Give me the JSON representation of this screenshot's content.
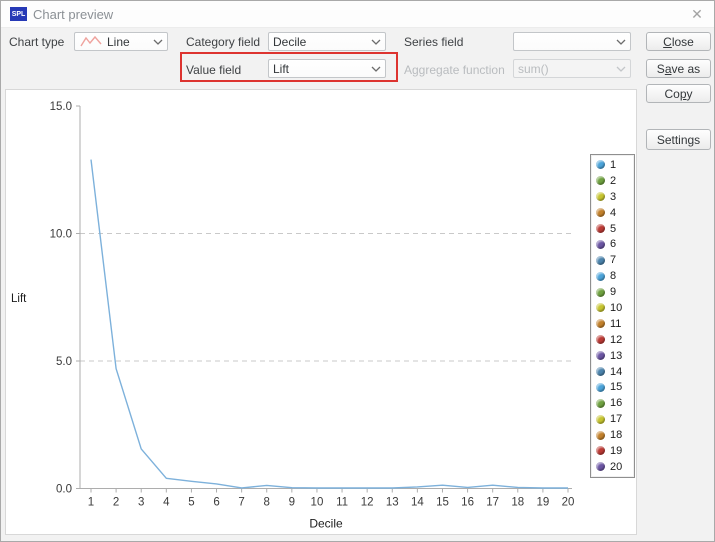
{
  "window": {
    "app_badge": "SPL",
    "title": "Chart preview",
    "close_glyph": "✕"
  },
  "toolbar": {
    "chart_type": {
      "label": "Chart type",
      "value": "Line"
    },
    "category_field": {
      "label": "Category field",
      "value": "Decile"
    },
    "series_field": {
      "label": "Series field",
      "value": ""
    },
    "value_field": {
      "label": "Value field",
      "value": "Lift"
    },
    "aggregate_function": {
      "label": "Aggregate function",
      "value": "sum()",
      "disabled": true
    },
    "highlight_color": "#dd3430"
  },
  "buttons": {
    "close": {
      "pre": "",
      "key": "C",
      "post": "lose"
    },
    "save_as": {
      "pre": "S",
      "key": "a",
      "post": "ve as"
    },
    "copy": {
      "pre": "Co",
      "key": "p",
      "post": "y"
    },
    "settings": {
      "pre": "Settings",
      "key": "",
      "post": ""
    }
  },
  "chart_data": {
    "type": "line",
    "title": "",
    "xlabel": "Decile",
    "ylabel": "Lift",
    "x": [
      1,
      2,
      3,
      4,
      5,
      6,
      7,
      8,
      9,
      10,
      11,
      12,
      13,
      14,
      15,
      16,
      17,
      18,
      19,
      20
    ],
    "series": [
      {
        "name": "Lift",
        "values": [
          12.9,
          4.7,
          1.55,
          0.4,
          0.28,
          0.18,
          0.02,
          0.12,
          0.03,
          0.02,
          0.02,
          0.02,
          0.02,
          0.06,
          0.13,
          0.04,
          0.13,
          0.04,
          0.02,
          0.02
        ]
      }
    ],
    "ylim": [
      0,
      15
    ],
    "yticks": [
      0,
      5,
      10,
      15
    ],
    "ytick_labels": [
      "0.0",
      "5.0",
      "10.0",
      "15.0"
    ],
    "dashed_gridlines_at": [
      5,
      10
    ],
    "line_color": "#7db1db",
    "axis_color": "#adadad",
    "grid_color": "#c9c9c9",
    "tick_text_color": "#3a3a3a",
    "legend_position": "right",
    "legend_entries": [
      {
        "label": "1",
        "color": "#4ba3d9"
      },
      {
        "label": "2",
        "color": "#6fa140"
      },
      {
        "label": "3",
        "color": "#c6c42f"
      },
      {
        "label": "4",
        "color": "#c2802b"
      },
      {
        "label": "5",
        "color": "#bb3a35"
      },
      {
        "label": "6",
        "color": "#6b55a3"
      },
      {
        "label": "7",
        "color": "#4b83ac"
      },
      {
        "label": "8",
        "color": "#4ba3d9"
      },
      {
        "label": "9",
        "color": "#6fa140"
      },
      {
        "label": "10",
        "color": "#c6c42f"
      },
      {
        "label": "11",
        "color": "#c2802b"
      },
      {
        "label": "12",
        "color": "#bb3a35"
      },
      {
        "label": "13",
        "color": "#6b55a3"
      },
      {
        "label": "14",
        "color": "#4b83ac"
      },
      {
        "label": "15",
        "color": "#4ba3d9"
      },
      {
        "label": "16",
        "color": "#6fa140"
      },
      {
        "label": "17",
        "color": "#c6c42f"
      },
      {
        "label": "18",
        "color": "#c2802b"
      },
      {
        "label": "19",
        "color": "#bb3a35"
      },
      {
        "label": "20",
        "color": "#6b55a3"
      }
    ]
  }
}
